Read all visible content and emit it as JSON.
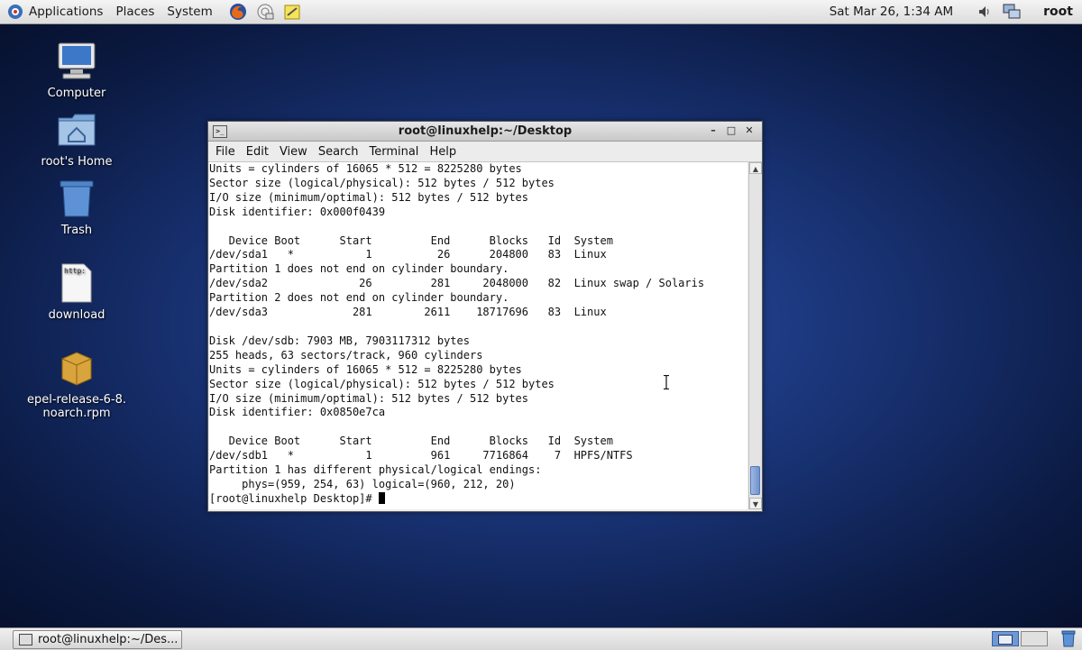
{
  "top_panel": {
    "menus": [
      "Applications",
      "Places",
      "System"
    ],
    "launchers": [
      "firefox-icon",
      "mail-client-icon",
      "note-editor-icon"
    ],
    "clock": "Sat Mar 26,  1:34 AM",
    "user": "root"
  },
  "desktop_icons": [
    {
      "label": "Computer",
      "icon": "computer-icon"
    },
    {
      "label": "root's Home",
      "icon": "home-folder-icon"
    },
    {
      "label": "Trash",
      "icon": "trash-icon"
    },
    {
      "label": "download",
      "icon": "text-file-icon",
      "icon_text": "http:"
    },
    {
      "label_line1": "epel-release-6-8.",
      "label_line2": "noarch.rpm",
      "icon": "package-icon"
    }
  ],
  "terminal": {
    "title": "root@linuxhelp:~/Desktop",
    "window_controls": {
      "minimize": "–",
      "maximize": "□",
      "close": "✕"
    },
    "menu": [
      "File",
      "Edit",
      "View",
      "Search",
      "Terminal",
      "Help"
    ],
    "prompt": "[root@linuxhelp Desktop]# ",
    "lines": [
      "Units = cylinders of 16065 * 512 = 8225280 bytes",
      "Sector size (logical/physical): 512 bytes / 512 bytes",
      "I/O size (minimum/optimal): 512 bytes / 512 bytes",
      "Disk identifier: 0x000f0439",
      "",
      "   Device Boot      Start         End      Blocks   Id  System",
      "/dev/sda1   *           1          26      204800   83  Linux",
      "Partition 1 does not end on cylinder boundary.",
      "/dev/sda2              26         281     2048000   82  Linux swap / Solaris",
      "Partition 2 does not end on cylinder boundary.",
      "/dev/sda3             281        2611    18717696   83  Linux",
      "",
      "Disk /dev/sdb: 7903 MB, 7903117312 bytes",
      "255 heads, 63 sectors/track, 960 cylinders",
      "Units = cylinders of 16065 * 512 = 8225280 bytes",
      "Sector size (logical/physical): 512 bytes / 512 bytes",
      "I/O size (minimum/optimal): 512 bytes / 512 bytes",
      "Disk identifier: 0x0850e7ca",
      "",
      "   Device Boot      Start         End      Blocks   Id  System",
      "/dev/sdb1   *           1         961     7716864    7  HPFS/NTFS",
      "Partition 1 has different physical/logical endings:",
      "     phys=(959, 254, 63) logical=(960, 212, 20)"
    ]
  },
  "taskbar": {
    "window_button": "root@linuxhelp:~/Des..."
  },
  "colors": {
    "desktop": "#17306f",
    "panel": "#e4e4e4",
    "workspace_active": "#6d99d8"
  }
}
